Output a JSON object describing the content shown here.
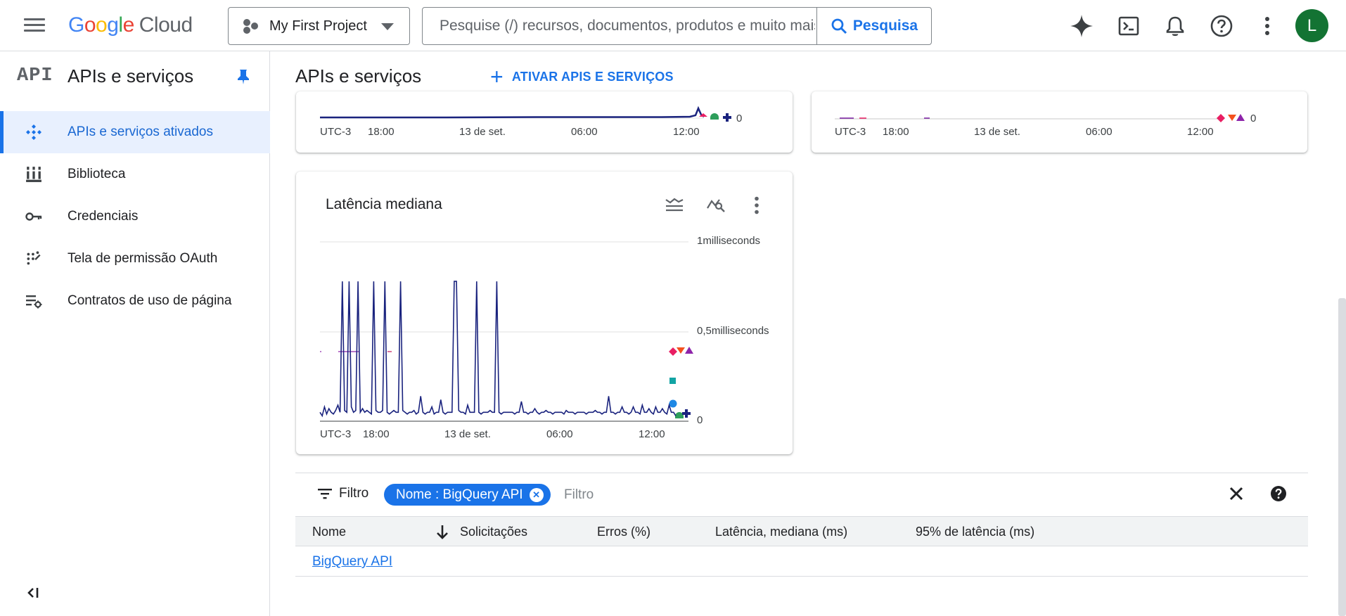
{
  "header": {
    "brand": {
      "google": "Google",
      "cloud": "Cloud"
    },
    "project": "My First Project",
    "search_placeholder": "Pesquise (/) recursos, documentos, produtos e muito mais",
    "search_button": "Pesquisa",
    "avatar_initial": "L"
  },
  "sidebar": {
    "api_badge": "API",
    "title": "APIs e serviços",
    "items": [
      {
        "label": "APIs e serviços ativados",
        "icon": "api-diamond-icon",
        "active": true
      },
      {
        "label": "Biblioteca",
        "icon": "library-icon",
        "active": false
      },
      {
        "label": "Credenciais",
        "icon": "key-icon",
        "active": false
      },
      {
        "label": "Tela de permissão OAuth",
        "icon": "oauth-icon",
        "active": false
      },
      {
        "label": "Contratos de uso de página",
        "icon": "settings-list-icon",
        "active": false
      }
    ]
  },
  "main": {
    "title": "APIs e serviços",
    "enable_button": "ATIVAR APIS E SERVIÇOS"
  },
  "colors": {
    "accent": "#1a73e8",
    "series_line": "#1a237e"
  },
  "charts": {
    "top_left": {
      "x_ticks": [
        "UTC-3",
        "18:00",
        "13 de set.",
        "06:00",
        "12:00"
      ],
      "y_label": "0"
    },
    "top_right": {
      "x_ticks": [
        "UTC-3",
        "18:00",
        "13 de set.",
        "06:00",
        "12:00"
      ],
      "y_label": "0"
    },
    "latency": {
      "title": "Latência mediana"
    }
  },
  "chart_data": {
    "type": "line",
    "title": "Latência mediana",
    "x_ticks": [
      "UTC-3",
      "18:00",
      "13 de set.",
      "06:00",
      "12:00"
    ],
    "y_ticks": [
      "1milliseconds",
      "0,5milliseconds",
      "0"
    ],
    "ylim": [
      0,
      1
    ],
    "y_unit": "milliseconds",
    "series": [
      {
        "values": [
          0.05,
          0.03,
          0.08,
          0.04,
          0.07,
          0.05,
          0.04,
          0.06,
          0.09,
          0.05,
          0.78,
          0.06,
          0.05,
          0.78,
          0.08,
          0.05,
          0.06,
          0.78,
          0.05,
          0.07,
          0.05,
          0.06,
          0.05,
          0.04,
          0.78,
          0.06,
          0.05,
          0.05,
          0.06,
          0.78,
          0.05,
          0.04,
          0.05,
          0.06,
          0.05,
          0.05,
          0.78,
          0.06,
          0.05,
          0.04,
          0.05,
          0.05,
          0.06,
          0.04,
          0.05,
          0.14,
          0.05,
          0.04,
          0.05,
          0.05,
          0.08,
          0.04,
          0.05,
          0.05,
          0.12,
          0.05,
          0.04,
          0.05,
          0.05,
          0.05,
          0.78,
          0.78,
          0.06,
          0.05,
          0.05,
          0.04,
          0.09,
          0.05,
          0.05,
          0.05,
          0.78,
          0.05,
          0.04,
          0.05,
          0.05,
          0.05,
          0.06,
          0.05,
          0.05,
          0.78,
          0.05,
          0.04,
          0.05,
          0.05,
          0.05,
          0.05,
          0.05,
          0.04,
          0.05,
          0.05,
          0.11,
          0.05,
          0.05,
          0.04,
          0.05,
          0.05,
          0.07,
          0.05,
          0.04,
          0.05,
          0.05,
          0.06,
          0.05,
          0.05,
          0.04,
          0.05,
          0.05,
          0.05,
          0.05,
          0.04,
          0.06,
          0.05,
          0.05,
          0.05,
          0.04,
          0.05,
          0.05,
          0.05,
          0.05,
          0.04,
          0.05,
          0.05,
          0.05,
          0.06,
          0.05,
          0.05,
          0.04,
          0.05,
          0.05,
          0.14,
          0.05,
          0.05,
          0.04,
          0.05,
          0.05,
          0.08,
          0.05,
          0.05,
          0.04,
          0.05,
          0.08,
          0.05,
          0.05,
          0.04,
          0.09,
          0.05,
          0.05,
          0.07,
          0.05,
          0.04,
          0.08,
          0.05,
          0.05,
          0.07,
          0.05,
          0.04,
          0.09,
          0.05,
          0.05,
          0.03
        ]
      }
    ]
  },
  "filter": {
    "label": "Filtro",
    "chip": "Nome : BigQuery API",
    "placeholder": "Filtro"
  },
  "table": {
    "columns": [
      "Nome",
      "Solicitações",
      "Erros (%)",
      "Latência, mediana (ms)",
      "95% de latência (ms)"
    ],
    "rows": [
      {
        "name": "BigQuery API"
      }
    ]
  }
}
